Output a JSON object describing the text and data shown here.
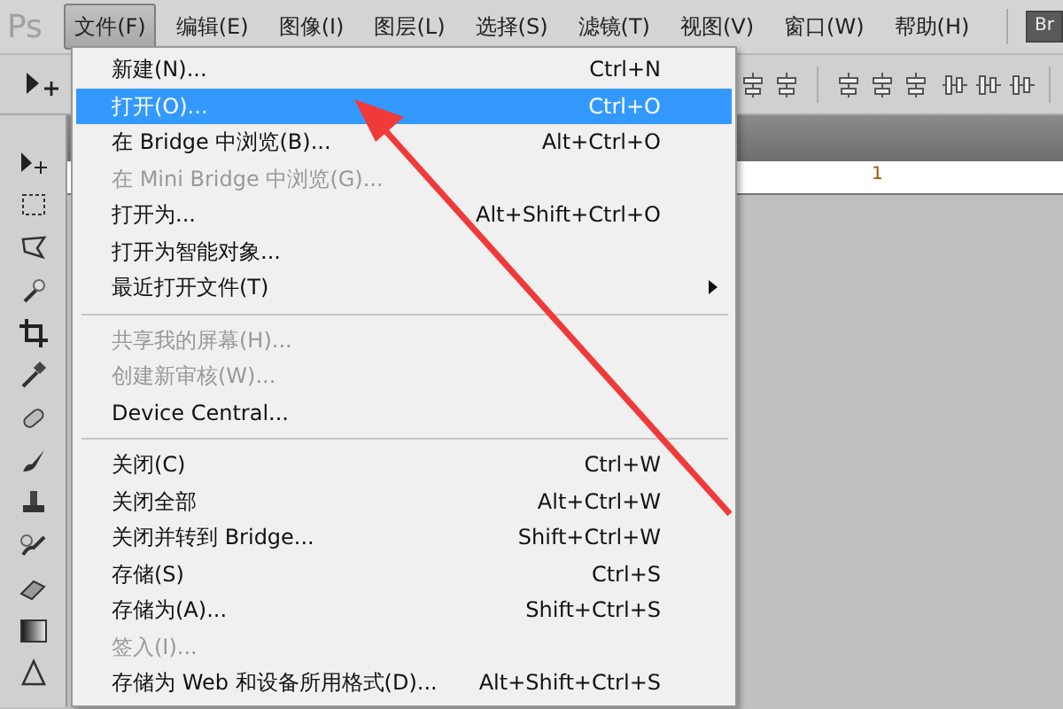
{
  "app_logo": "Ps",
  "menu_bar": [
    {
      "label": "文件(F)",
      "selected": true
    },
    {
      "label": "编辑(E)",
      "selected": false
    },
    {
      "label": "图像(I)",
      "selected": false
    },
    {
      "label": "图层(L)",
      "selected": false
    },
    {
      "label": "选择(S)",
      "selected": false
    },
    {
      "label": "滤镜(T)",
      "selected": false
    },
    {
      "label": "视图(V)",
      "selected": false
    },
    {
      "label": "窗口(W)",
      "selected": false
    },
    {
      "label": "帮助(H)",
      "selected": false
    }
  ],
  "bridge_button": "Br",
  "ruler": {
    "label": "1"
  },
  "file_menu": {
    "items": [
      {
        "kind": "item",
        "label": "新建(N)...",
        "shortcut": "Ctrl+N",
        "disabled": false,
        "selected": false
      },
      {
        "kind": "item",
        "label": "打开(O)...",
        "shortcut": "Ctrl+O",
        "disabled": false,
        "selected": true
      },
      {
        "kind": "item",
        "label": "在 Bridge 中浏览(B)...",
        "shortcut": "Alt+Ctrl+O",
        "disabled": false,
        "selected": false
      },
      {
        "kind": "item",
        "label": "在 Mini Bridge 中浏览(G)...",
        "disabled": true,
        "selected": false
      },
      {
        "kind": "item",
        "label": "打开为...",
        "shortcut": "Alt+Shift+Ctrl+O",
        "disabled": false,
        "selected": false
      },
      {
        "kind": "item",
        "label": "打开为智能对象...",
        "disabled": false,
        "selected": false
      },
      {
        "kind": "submenu",
        "label": "最近打开文件(T)",
        "disabled": false,
        "selected": false
      },
      {
        "kind": "separator"
      },
      {
        "kind": "item",
        "label": "共享我的屏幕(H)...",
        "disabled": true,
        "selected": false
      },
      {
        "kind": "item",
        "label": "创建新审核(W)...",
        "disabled": true,
        "selected": false
      },
      {
        "kind": "item",
        "label": "Device Central...",
        "disabled": false,
        "selected": false
      },
      {
        "kind": "separator"
      },
      {
        "kind": "item",
        "label": "关闭(C)",
        "shortcut": "Ctrl+W",
        "disabled": false,
        "selected": false
      },
      {
        "kind": "item",
        "label": "关闭全部",
        "shortcut": "Alt+Ctrl+W",
        "disabled": false,
        "selected": false
      },
      {
        "kind": "item",
        "label": "关闭并转到 Bridge...",
        "shortcut": "Shift+Ctrl+W",
        "disabled": false,
        "selected": false
      },
      {
        "kind": "item",
        "label": "存储(S)",
        "shortcut": "Ctrl+S",
        "disabled": false,
        "selected": false
      },
      {
        "kind": "item",
        "label": "存储为(A)...",
        "shortcut": "Shift+Ctrl+S",
        "disabled": false,
        "selected": false
      },
      {
        "kind": "item",
        "label": "签入(I)...",
        "disabled": true,
        "selected": false
      },
      {
        "kind": "item",
        "label": "存储为 Web 和设备所用格式(D)...",
        "shortcut": "Alt+Shift+Ctrl+S",
        "disabled": false,
        "selected": false
      }
    ]
  }
}
